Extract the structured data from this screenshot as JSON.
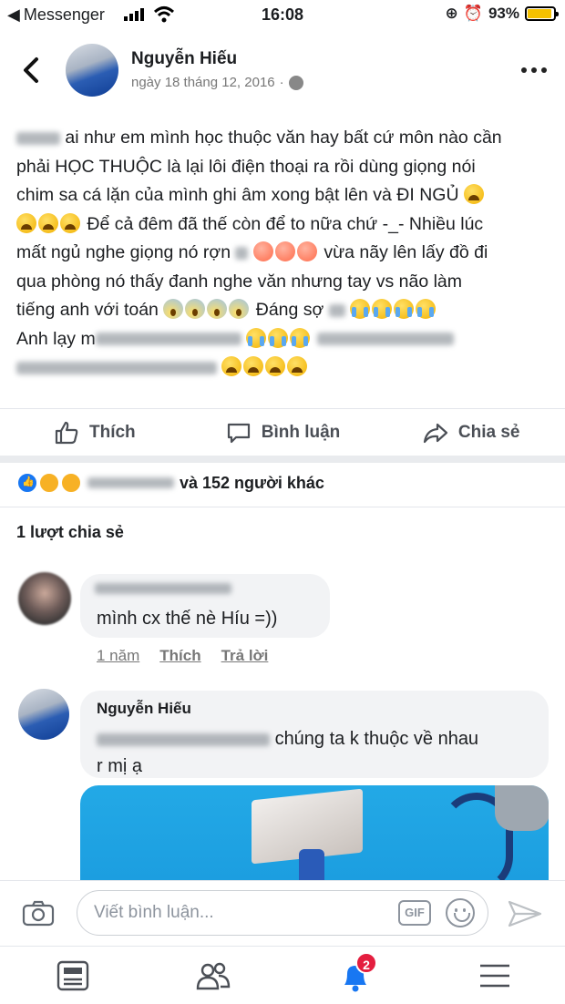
{
  "status_bar": {
    "back_app": "Messenger",
    "time": "16:08",
    "battery": "93%",
    "battery_level": 0.93
  },
  "header": {
    "author": "Nguyễn Hiếu",
    "date": "ngày 18 tháng 12, 2016",
    "separator": "·"
  },
  "post": {
    "lines": [
      "ai như em mình học thuộc văn hay bất cứ môn nào cần",
      "phải HỌC THUỘC là lại lôi điện thoại ra rồi dùng giọng nói",
      "chim sa cá lặn của mình ghi âm xong bật lên và ĐI NGỦ",
      "Để cả đêm đã thế còn để to nữa chứ -_- Nhiều lúc",
      "mất ngủ nghe giọng nó rợn",
      "vừa nãy lên lấy đồ đi",
      "qua phòng nó thấy đanh nghe văn nhưng tay  vs não làm",
      "tiếng anh với toán",
      "Đáng sợ",
      "Anh lạy m"
    ]
  },
  "actions": {
    "like": "Thích",
    "comment": "Bình luận",
    "share": "Chia sẻ"
  },
  "reactions": {
    "summary": "và 152 người khác"
  },
  "shares": "1 lượt chia sẻ",
  "comments": [
    {
      "text": "mình cx thế nè Híu =))",
      "time": "1 năm",
      "like": "Thích",
      "reply": "Trả lời"
    },
    {
      "author": "Nguyễn Hiếu",
      "text_part": "chúng ta k thuộc về nhau",
      "text_end": "r mị ạ"
    }
  ],
  "composer": {
    "placeholder": "Viết bình luận...",
    "gif": "GIF"
  },
  "tabbar": {
    "notifications_badge": "2"
  }
}
